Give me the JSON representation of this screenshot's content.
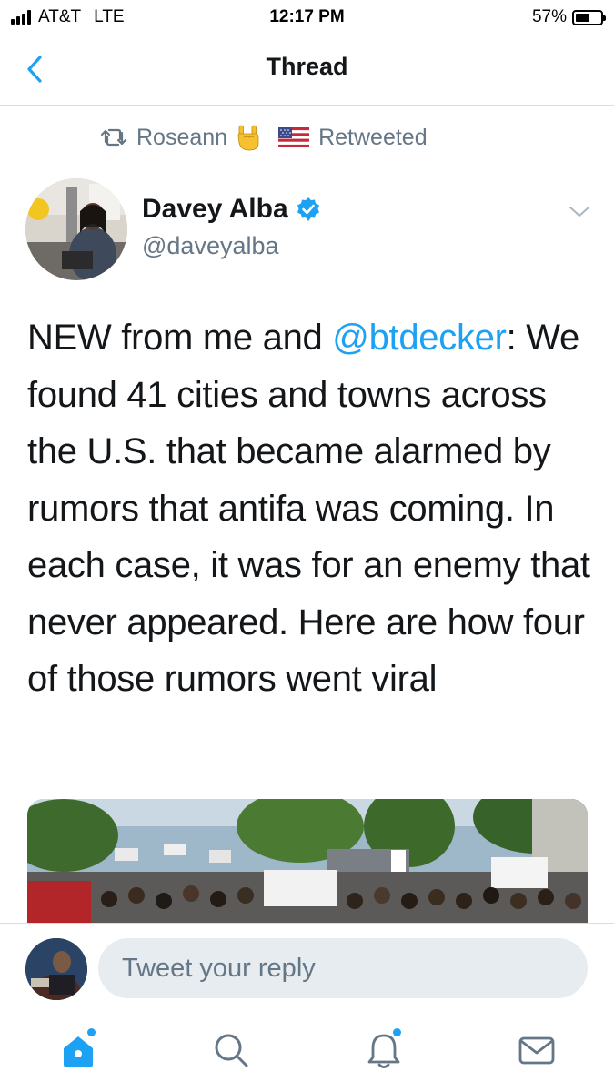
{
  "status_bar": {
    "carrier": "AT&T",
    "network": "LTE",
    "time": "12:17 PM",
    "battery": "57%",
    "battery_level": 0.57
  },
  "nav": {
    "title": "Thread",
    "back_icon": "chevron-left-icon"
  },
  "retweet": {
    "name": "Roseann",
    "label": "Retweeted",
    "icons": [
      "retweet-icon",
      "rock-on-hand-emoji",
      "us-flag-emoji"
    ]
  },
  "author": {
    "name": "Davey Alba",
    "handle": "@daveyalba",
    "verified": true
  },
  "tweet": {
    "prefix": "NEW from me and ",
    "mention": "@btdecker",
    "body": ": We found 41 cities and towns across the U.S. that became alarmed by rumors that antifa was coming. In each case, it was for an enemy that never appeared. Here are how four of those rumors went viral"
  },
  "reply": {
    "placeholder": "Tweet your reply"
  },
  "tabs": [
    {
      "icon": "home-icon",
      "active": true,
      "badge": true
    },
    {
      "icon": "search-icon",
      "active": false,
      "badge": false
    },
    {
      "icon": "notifications-bell-icon",
      "active": false,
      "badge": true
    },
    {
      "icon": "messages-envelope-icon",
      "active": false,
      "badge": false
    }
  ],
  "colors": {
    "accent": "#1da1f2",
    "text": "#14171a",
    "secondary": "#657786",
    "divider": "#d8dde1",
    "input_bg": "#e6ecf0"
  }
}
